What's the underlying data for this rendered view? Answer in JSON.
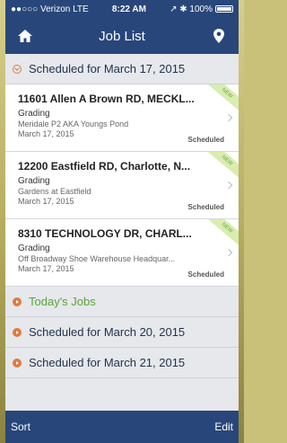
{
  "status": {
    "carrier": "●●○○○ Verizon LTE",
    "time": "8:22 AM",
    "right": "↗ ✱ 100%"
  },
  "nav": {
    "title": "Job List"
  },
  "sections": [
    {
      "label": "Scheduled for March 17, 2015"
    },
    {
      "label": "Today's Jobs"
    },
    {
      "label": "Scheduled for March 20, 2015"
    },
    {
      "label": "Scheduled for March 21, 2015"
    }
  ],
  "jobs": [
    {
      "title": "11601 Allen A Brown RD, MECKL...",
      "type": "Grading",
      "site": "Meridale P2 AKA Youngs Pond",
      "date": "March 17, 2015",
      "status": "Scheduled",
      "badge": "NEW"
    },
    {
      "title": "12200 Eastfield RD, Charlotte, N...",
      "type": "Grading",
      "site": "Gardens at Eastfield",
      "date": "March 17, 2015",
      "status": "Scheduled",
      "badge": "NEW"
    },
    {
      "title": "8310 TECHNOLOGY DR, CHARL...",
      "type": "Grading",
      "site": "Off Broadway Shoe Warehouse Headquar...",
      "date": "March 17, 2015",
      "status": "Scheduled",
      "badge": "NEW"
    }
  ],
  "footer": {
    "sort_label": "Sort",
    "edit_label": "Edit"
  },
  "colors": {
    "nav": "#28467a",
    "accent": "#e07a3c",
    "today": "#5aa33b"
  },
  "icons": {
    "home": "home-icon",
    "location": "location-pin-icon"
  }
}
